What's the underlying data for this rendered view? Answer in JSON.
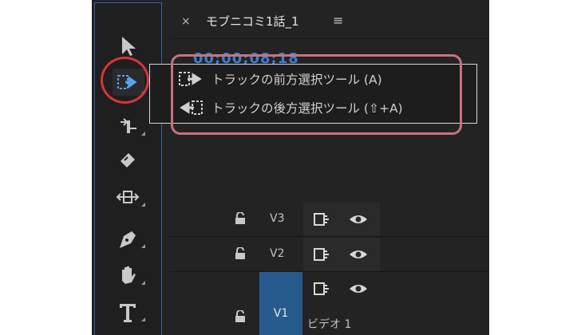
{
  "sequence": {
    "close_label": "×",
    "title": "モブニコミ1話_1",
    "menu_label": "≡",
    "timecode": "00;00;08;18"
  },
  "tools": [
    {
      "name": "selection-tool",
      "icon": "arrow-icon"
    },
    {
      "name": "track-select-forward-tool",
      "icon": "track-select-forward-icon",
      "active": true
    },
    {
      "name": "ripple-edit-tool",
      "icon": "ripple-edit-icon"
    },
    {
      "name": "razor-tool",
      "icon": "razor-icon"
    },
    {
      "name": "slip-tool",
      "icon": "slip-icon"
    },
    {
      "name": "pen-tool",
      "icon": "pen-icon"
    },
    {
      "name": "hand-tool",
      "icon": "hand-icon"
    },
    {
      "name": "type-tool",
      "icon": "type-icon"
    }
  ],
  "tooltip": {
    "items": [
      {
        "label": "トラックの前方選択ツール (A)"
      },
      {
        "label": "トラックの後方選択ツール (⇧+A)"
      }
    ]
  },
  "tracks": [
    {
      "name": "V3"
    },
    {
      "name": "V2"
    },
    {
      "name": "V1",
      "label": "ビデオ 1"
    }
  ],
  "colors": {
    "accent": "#2f63a8",
    "highlight_circle": "#d8343c",
    "highlight_box": "#c8727e",
    "timecode": "#3a7fd5"
  }
}
